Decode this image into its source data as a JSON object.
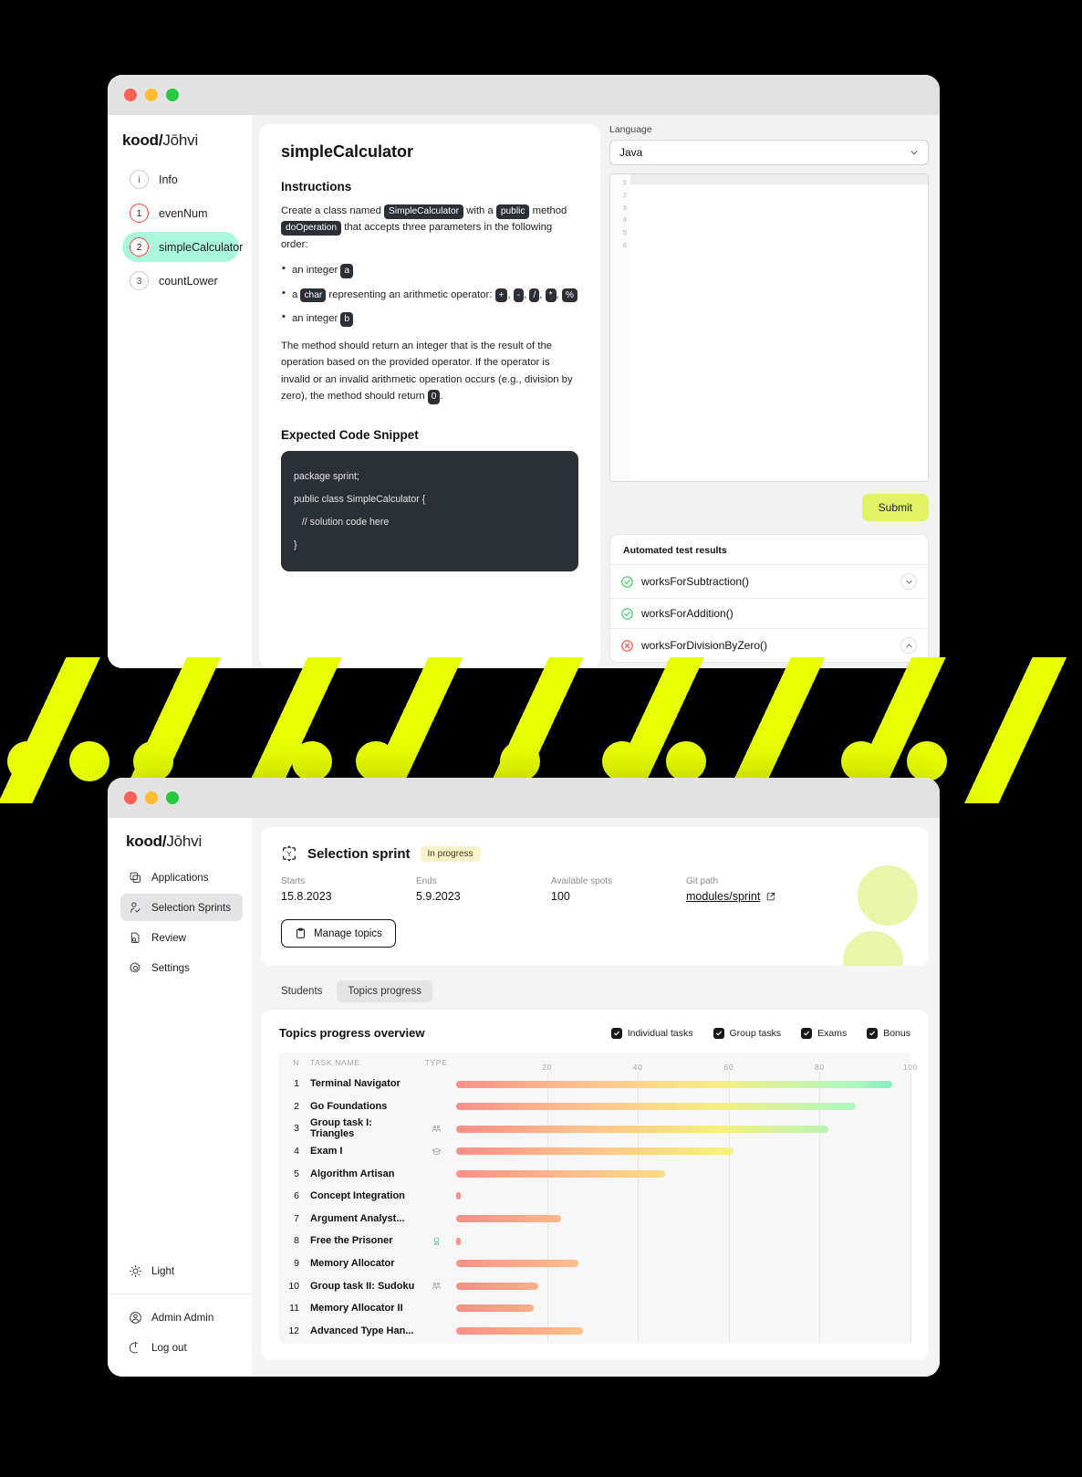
{
  "window1": {
    "brand": {
      "bold": "kood",
      "slash": "/",
      "rest": "Jōhvi"
    },
    "sidebar": {
      "items": [
        {
          "badge": "i",
          "label": "Info",
          "state": "info"
        },
        {
          "badge": "1",
          "label": "evenNum",
          "state": "red"
        },
        {
          "badge": "2",
          "label": "simpleCalculator",
          "state": "red-active"
        },
        {
          "badge": "3",
          "label": "countLower",
          "state": "plain"
        }
      ]
    },
    "task": {
      "title": "simpleCalculator",
      "instructions_heading": "Instructions",
      "intro_1": "Create a class named",
      "kw_class": "SimpleCalculator",
      "intro_2": "with a",
      "kw_public": "public",
      "intro_3": "method",
      "kw_method": "doOperation",
      "intro_4": "that accepts three parameters in the following order:",
      "bullets": [
        {
          "pre": "an integer",
          "kw": "a",
          "post": ""
        },
        {
          "pre": "a",
          "kw": "char",
          "post": "representing an arithmetic operator:",
          "ops": [
            "+",
            "-",
            "/",
            "*",
            "%"
          ]
        },
        {
          "pre": "an integer",
          "kw": "b",
          "post": ""
        }
      ],
      "outro_1": "The method should return an integer that is the result of the operation based on the provided operator. If the operator is invalid or an invalid arithmetic operation occurs (e.g., division by zero), the method should return",
      "outro_kw": "0",
      "outro_2": ".",
      "snippet_heading": "Expected Code Snippet",
      "snippet_lines": [
        "package sprint;",
        "public class SimpleCalculator {",
        "   // solution code here",
        "}"
      ]
    },
    "editor": {
      "language_label": "Language",
      "language_value": "Java",
      "language_options": [
        "Java"
      ],
      "line_numbers": [
        "1",
        "2",
        "3",
        "4",
        "5",
        "6"
      ],
      "code_value": "",
      "submit_label": "Submit"
    },
    "results": {
      "heading": "Automated test results",
      "items": [
        {
          "name": "worksForSubtraction()",
          "status": "pass",
          "caret": "down"
        },
        {
          "name": "worksForAddition()",
          "status": "pass",
          "caret": "none"
        },
        {
          "name": "worksForDivisionByZero()",
          "status": "fail",
          "caret": "up"
        }
      ]
    },
    "colors": {
      "accent_green": "#a9f7dd",
      "submit": "#e2f265",
      "pass": "#34c759",
      "fail": "#f0453a"
    }
  },
  "window2": {
    "brand": {
      "bold": "kood",
      "slash": "/",
      "rest": "Jōhvi"
    },
    "sidebar": {
      "items": [
        {
          "label": "Applications",
          "icon": "copy-icon",
          "active": false
        },
        {
          "label": "Selection Sprints",
          "icon": "user-check-icon",
          "active": true
        },
        {
          "label": "Review",
          "icon": "file-search-icon",
          "active": false
        },
        {
          "label": "Settings",
          "icon": "gear-icon",
          "active": false
        }
      ],
      "theme_label": "Light",
      "user_label": "Admin Admin",
      "logout_label": "Log out"
    },
    "sprint": {
      "title": "Selection sprint",
      "status": "In progress",
      "meta": [
        {
          "key": "Starts",
          "value": "15.8.2023"
        },
        {
          "key": "Ends",
          "value": "5.9.2023"
        },
        {
          "key": "Available spots",
          "value": "100"
        },
        {
          "key": "Git path",
          "value": "modules/sprint",
          "link": true
        }
      ],
      "manage_button": "Manage topics"
    },
    "tabs": [
      {
        "label": "Students",
        "active": false
      },
      {
        "label": "Topics progress",
        "active": true
      }
    ],
    "chart_data": {
      "type": "bar",
      "title": "Topics progress overview",
      "orientation": "horizontal",
      "xlabel": "",
      "ylabel": "",
      "xlim": [
        0,
        100
      ],
      "ticks": [
        20,
        40,
        60,
        80,
        100
      ],
      "grid": true,
      "columns": [
        "N",
        "TASK NAME",
        "TYPE"
      ],
      "legend_position": "top-right",
      "legend": [
        {
          "label": "Individual tasks",
          "checked": true
        },
        {
          "label": "Group tasks",
          "checked": true
        },
        {
          "label": "Exams",
          "checked": true
        },
        {
          "label": "Bonus",
          "checked": true
        }
      ],
      "categories": [
        "Terminal Navigator",
        "Go Foundations",
        "Group task I: Triangles",
        "Exam I",
        "Algorithm Artisan",
        "Concept Integration",
        "Argument Analyst...",
        "Free the Prisoner",
        "Memory Allocator",
        "Group task II: Sudoku",
        "Memory Allocator II",
        "Advanced Type Han..."
      ],
      "values": [
        96,
        88,
        82,
        61,
        46,
        1,
        23,
        1,
        27,
        18,
        17,
        28
      ],
      "rows": [
        {
          "n": "1",
          "name": "Terminal Navigator",
          "type": "",
          "value": 96
        },
        {
          "n": "2",
          "name": "Go Foundations",
          "type": "",
          "value": 88
        },
        {
          "n": "3",
          "name": "Group task I: Triangles",
          "type": "group",
          "value": 82
        },
        {
          "n": "4",
          "name": "Exam I",
          "type": "exam",
          "value": 61
        },
        {
          "n": "5",
          "name": "Algorithm Artisan",
          "type": "",
          "value": 46
        },
        {
          "n": "6",
          "name": "Concept Integration",
          "type": "",
          "value": 1
        },
        {
          "n": "7",
          "name": "Argument Analyst...",
          "type": "",
          "value": 23
        },
        {
          "n": "8",
          "name": "Free the Prisoner",
          "type": "bonus",
          "value": 1
        },
        {
          "n": "9",
          "name": "Memory Allocator",
          "type": "",
          "value": 27
        },
        {
          "n": "10",
          "name": "Group task II: Sudoku",
          "type": "group",
          "value": 18
        },
        {
          "n": "11",
          "name": "Memory Allocator II",
          "type": "",
          "value": 17
        },
        {
          "n": "12",
          "name": "Advanced Type Han...",
          "type": "",
          "value": 28
        }
      ]
    }
  }
}
